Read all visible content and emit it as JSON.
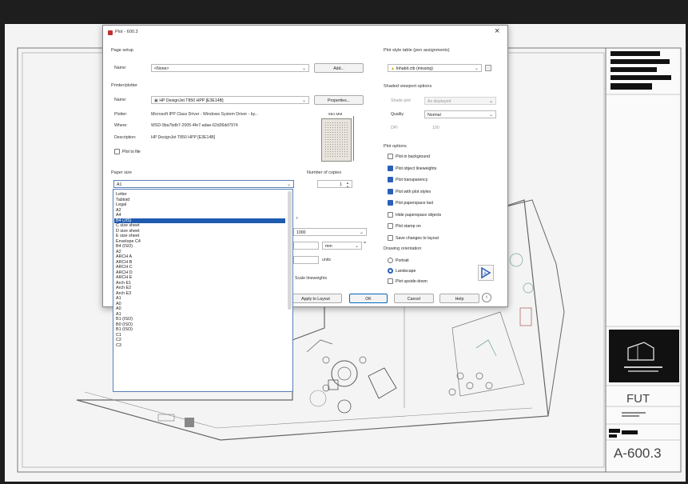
{
  "sheet": {
    "tb_label": "FUT",
    "tb_sheet_number": "A-600.3"
  },
  "dialog": {
    "title": "Plot - 600.3",
    "close_glyph": "×",
    "page_setup": {
      "section_label": "Page setup",
      "name_label": "Name:",
      "name_value": "<None>",
      "add_button": "Add..."
    },
    "printer": {
      "section_label": "Printer/plotter",
      "name_label": "Name:",
      "name_value": "HP DesignJet T850 HPP [E3E14B]",
      "properties_button": "Properties...",
      "plotter_label": "Plotter:",
      "plotter_value": "Microsoft IPP Class Driver - Windows System Driver - by...",
      "where_label": "Where:",
      "where_value": "WSD-9ba7bdb7-2005-4fe7-adae-62d36dd7974",
      "description_label": "Description:",
      "description_value": "HP DesignJet T850 HPP [E3E14B]",
      "plot_to_file": "Plot to file",
      "preview_dim": "594 MM"
    },
    "paper_size": {
      "section_label": "Paper size",
      "selected": "A1",
      "options": [
        "Letter",
        "Tabloid",
        "Legal",
        "A2",
        "A4",
        "B4 (JIS)",
        "C size sheet",
        "D size sheet",
        "E size sheet",
        "Envelope C4",
        "B4 (ISO)",
        "A2",
        "ARCH A",
        "ARCH B",
        "ARCH C",
        "ARCH D",
        "ARCH E",
        "Arch E1",
        "Arch E2",
        "Arch E3",
        "A1",
        "A0",
        "A0",
        "A1",
        "B1 (ISO)",
        "B0 (ISO)",
        "B1 (ISO)",
        "C1",
        "C2",
        "C3"
      ],
      "selected_index": 5
    },
    "copies": {
      "label": "Number of copies",
      "value": "1"
    },
    "scale": {
      "value": "1000",
      "unit": "mm",
      "units_label": "units",
      "lineweights": "Scale lineweights"
    },
    "plot_style": {
      "section_label": "Plot style table (pen assignments)",
      "value": "Inhabit.ctb (missing)"
    },
    "shaded": {
      "section_label": "Shaded viewport options",
      "shade_label": "Shade plot",
      "shade_value": "As displayed",
      "quality_label": "Quality",
      "quality_value": "Normal",
      "dpi_label": "DPI",
      "dpi_value": "100"
    },
    "plot_options": {
      "section_label": "Plot options",
      "items": [
        {
          "label": "Plot in background",
          "checked": false
        },
        {
          "label": "Plot object lineweights",
          "checked": true
        },
        {
          "label": "Plot transparency",
          "checked": true
        },
        {
          "label": "Plot with plot styles",
          "checked": true
        },
        {
          "label": "Plot paperspace last",
          "checked": true
        },
        {
          "label": "Hide paperspace objects",
          "checked": false
        },
        {
          "label": "Plot stamp on",
          "checked": false
        },
        {
          "label": "Save changes to layout",
          "checked": false
        }
      ]
    },
    "orientation": {
      "section_label": "Drawing orientation",
      "portrait": "Portrait",
      "landscape": "Landscape",
      "upside_down": "Plot upside-down"
    },
    "footer": {
      "apply": "Apply to Layout",
      "ok": "OK",
      "cancel": "Cancel",
      "help": "Help"
    }
  },
  "colors": {
    "accent": "#2b5fb7",
    "selection": "#1f5bb0",
    "backdrop": "#1e1e1e"
  }
}
